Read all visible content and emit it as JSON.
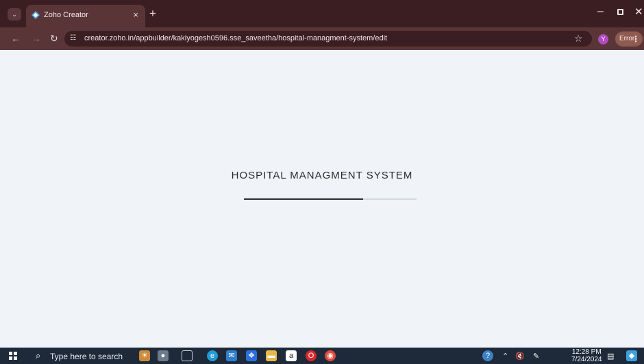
{
  "browser": {
    "tab_title": "Zoho Creator",
    "tab_close": "×",
    "new_tab": "+",
    "url": "creator.zoho.in/appbuilder/kakiyogesh0596.sse_saveetha/hospital-managment-system/edit",
    "profile_initial": "Y",
    "error_label": "Error"
  },
  "page": {
    "title": "HOSPITAL MANAGMENT SYSTEM",
    "progress": 0.69
  },
  "taskbar": {
    "search_placeholder": "Type here to search",
    "time": "12:28 PM",
    "date": "7/24/2024"
  },
  "colors": {
    "tab_strip": "#3a1e22",
    "toolbar": "#5a3537",
    "page_bg": "#f0f4f8",
    "progress_fill": "#2c2c2c",
    "taskbar": "#1e2a3a"
  }
}
